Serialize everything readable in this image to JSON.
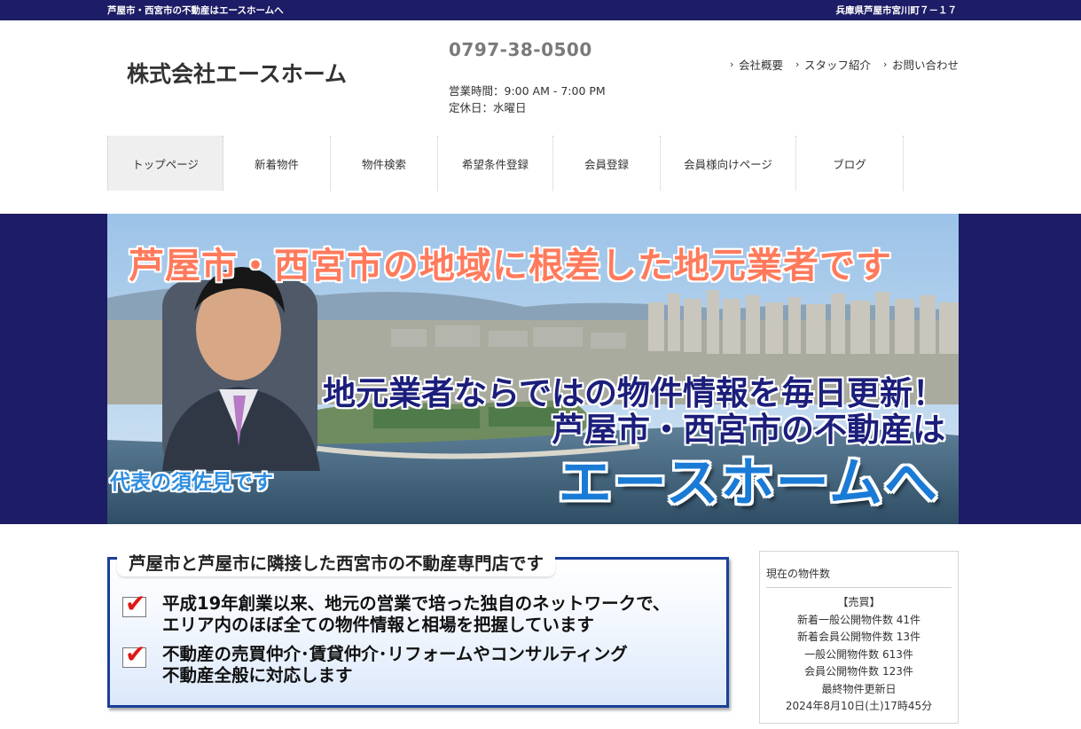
{
  "topbar": {
    "tagline": "芦屋市・西宮市の不動産はエースホームへ",
    "address": "兵庫県芦屋市宮川町７－１７"
  },
  "header": {
    "company_name": "株式会社エースホーム",
    "phone": "0797-38-0500",
    "hours": "営業時間：9:00 AM - 7:00 PM",
    "holiday": "定休日：水曜日",
    "links": [
      {
        "label": "会社概要"
      },
      {
        "label": "スタッフ紹介"
      },
      {
        "label": "お問い合わせ"
      }
    ],
    "link_marker": "›"
  },
  "nav": {
    "items": [
      {
        "label": "トップページ",
        "active": true
      },
      {
        "label": "新着物件"
      },
      {
        "label": "物件検索"
      },
      {
        "label": "希望条件登録"
      },
      {
        "label": "会員登録"
      },
      {
        "label": "会員様向けページ"
      },
      {
        "label": "ブログ"
      }
    ]
  },
  "hero": {
    "headline": "芦屋市・西宮市の地域に根差した地元業者です",
    "sub1": "地元業者ならではの物件情報を毎日更新！",
    "sub2": "芦屋市・西宮市の不動産は",
    "brand": "エースホームへ",
    "representative": "代表の須佐見です"
  },
  "promo": {
    "title": "芦屋市と芦屋市に隣接した西宮市の不動産専門店です",
    "check_mark": "✔",
    "points": [
      {
        "line1": "平成19年創業以来、地元の営業で培った独自のネットワークで、",
        "line2": "エリア内のほぼ全ての物件情報と相場を把握しています"
      },
      {
        "line1": "不動産の売買仲介･賃貸仲介･リフォームやコンサルティング",
        "line2": "不動産全般に対応します"
      }
    ]
  },
  "counts": {
    "heading": "現在の物件数",
    "category": "【売買】",
    "rows": [
      "新着一般公開物件数 41件",
      "新着会員公開物件数 13件",
      "一般公開物件数 613件",
      "会員公開物件数 123件",
      "最終物件更新日",
      "2024年8月10日(土)17時45分"
    ]
  },
  "colors": {
    "navy": "#1d1c66",
    "headline_orange": "#ff7a5c",
    "brand_blue": "#1a7bd6",
    "check_red": "#e01818"
  }
}
